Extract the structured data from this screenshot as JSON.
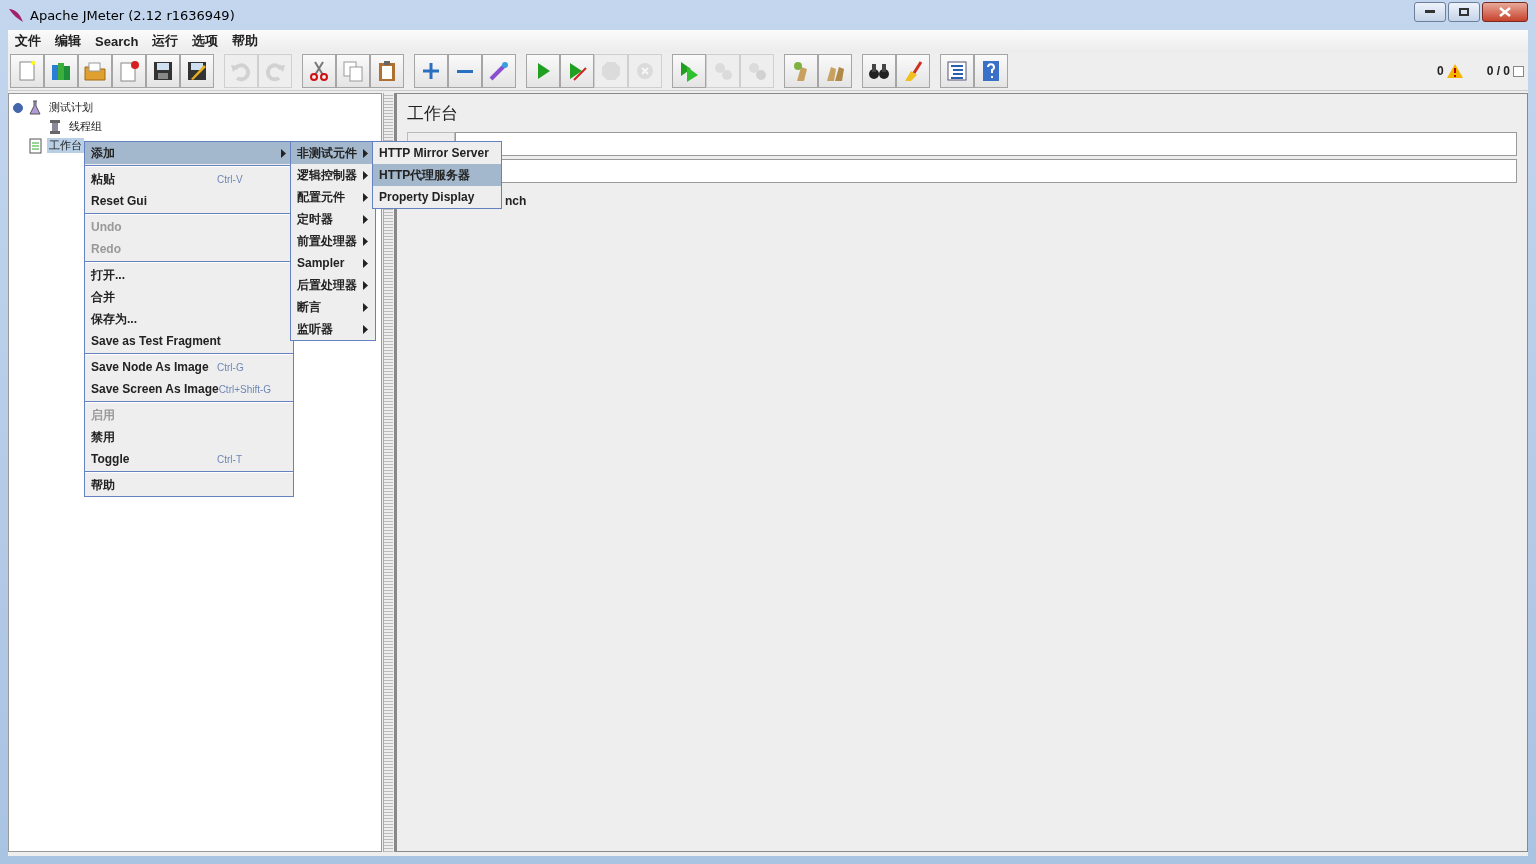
{
  "window": {
    "title": "Apache JMeter (2.12 r1636949)"
  },
  "menu_bar": [
    "文件",
    "编辑",
    "Search",
    "运行",
    "选项",
    "帮助"
  ],
  "toolbar": [
    [
      {
        "kind": "new",
        "disabled": false
      },
      {
        "kind": "templates",
        "disabled": false
      },
      {
        "kind": "open",
        "disabled": false
      },
      {
        "kind": "close",
        "disabled": false
      },
      {
        "kind": "save",
        "disabled": false
      },
      {
        "kind": "save-as",
        "disabled": false
      }
    ],
    [
      {
        "kind": "undo",
        "disabled": true
      },
      {
        "kind": "redo",
        "disabled": true
      }
    ],
    [
      {
        "kind": "cut",
        "disabled": false
      },
      {
        "kind": "copy",
        "disabled": false
      },
      {
        "kind": "paste",
        "disabled": false
      }
    ],
    [
      {
        "kind": "expand",
        "disabled": false
      },
      {
        "kind": "collapse",
        "disabled": false
      },
      {
        "kind": "toggle",
        "disabled": false
      }
    ],
    [
      {
        "kind": "start",
        "disabled": false
      },
      {
        "kind": "start-no-pause",
        "disabled": false
      },
      {
        "kind": "stop",
        "disabled": true
      },
      {
        "kind": "shutdown",
        "disabled": true
      }
    ],
    [
      {
        "kind": "remote-start",
        "disabled": false
      },
      {
        "kind": "remote-stop",
        "disabled": true
      },
      {
        "kind": "remote-shutdown",
        "disabled": true
      }
    ],
    [
      {
        "kind": "clear",
        "disabled": false
      },
      {
        "kind": "clear-all",
        "disabled": false
      }
    ],
    [
      {
        "kind": "search",
        "disabled": false
      },
      {
        "kind": "reset-search",
        "disabled": false
      }
    ],
    [
      {
        "kind": "function-helper",
        "disabled": false
      },
      {
        "kind": "help",
        "disabled": false
      }
    ]
  ],
  "status": {
    "warnings": "0",
    "threads": "0 / 0"
  },
  "tree": [
    {
      "label": "测试计划",
      "kind": "plan",
      "selected": false,
      "expanded": true,
      "children": [
        {
          "label": "线程组",
          "kind": "thread-group",
          "selected": false
        }
      ]
    },
    {
      "label": "工作台",
      "kind": "workbench",
      "selected": true
    }
  ],
  "panel": {
    "title": "工作台",
    "partial_text": "nch"
  },
  "context_menus": [
    {
      "items": [
        {
          "kind": "item",
          "label": "添加",
          "selected": true,
          "disabled": false,
          "submenu": true
        },
        {
          "kind": "separator"
        },
        {
          "kind": "item",
          "label": "粘贴",
          "shortcut": "Ctrl-V",
          "selected": false,
          "disabled": false,
          "submenu": false
        },
        {
          "kind": "item",
          "label": "Reset Gui",
          "selected": false,
          "disabled": false,
          "submenu": false
        },
        {
          "kind": "separator"
        },
        {
          "kind": "item",
          "label": "Undo",
          "selected": false,
          "disabled": true,
          "submenu": false
        },
        {
          "kind": "item",
          "label": "Redo",
          "selected": false,
          "disabled": true,
          "submenu": false
        },
        {
          "kind": "separator"
        },
        {
          "kind": "item",
          "label": "打开...",
          "selected": false,
          "disabled": false,
          "submenu": false
        },
        {
          "kind": "item",
          "label": "合并",
          "selected": false,
          "disabled": false,
          "submenu": false
        },
        {
          "kind": "item",
          "label": "保存为...",
          "selected": false,
          "disabled": false,
          "submenu": false
        },
        {
          "kind": "item",
          "label": "Save as Test Fragment",
          "selected": false,
          "disabled": false,
          "submenu": false
        },
        {
          "kind": "separator"
        },
        {
          "kind": "item",
          "label": "Save Node As Image",
          "shortcut": "Ctrl-G",
          "selected": false,
          "disabled": false,
          "submenu": false
        },
        {
          "kind": "item",
          "label": "Save Screen As Image",
          "shortcut": "Ctrl+Shift-G",
          "selected": false,
          "disabled": false,
          "submenu": false
        },
        {
          "kind": "separator"
        },
        {
          "kind": "item",
          "label": "启用",
          "selected": false,
          "disabled": true,
          "submenu": false
        },
        {
          "kind": "item",
          "label": "禁用",
          "selected": false,
          "disabled": false,
          "submenu": false
        },
        {
          "kind": "item",
          "label": "Toggle",
          "shortcut": "Ctrl-T",
          "selected": false,
          "disabled": false,
          "submenu": false
        },
        {
          "kind": "separator"
        },
        {
          "kind": "item",
          "label": "帮助",
          "selected": false,
          "disabled": false,
          "submenu": false
        }
      ]
    },
    {
      "items": [
        {
          "kind": "item",
          "label": "非测试元件",
          "selected": true,
          "disabled": false,
          "submenu": true
        },
        {
          "kind": "item",
          "label": "逻辑控制器",
          "selected": false,
          "disabled": false,
          "submenu": true
        },
        {
          "kind": "item",
          "label": "配置元件",
          "selected": false,
          "disabled": false,
          "submenu": true
        },
        {
          "kind": "item",
          "label": "定时器",
          "selected": false,
          "disabled": false,
          "submenu": true
        },
        {
          "kind": "item",
          "label": "前置处理器",
          "selected": false,
          "disabled": false,
          "submenu": true
        },
        {
          "kind": "item",
          "label": "Sampler",
          "selected": false,
          "disabled": false,
          "submenu": true
        },
        {
          "kind": "item",
          "label": "后置处理器",
          "selected": false,
          "disabled": false,
          "submenu": true
        },
        {
          "kind": "item",
          "label": "断言",
          "selected": false,
          "disabled": false,
          "submenu": true
        },
        {
          "kind": "item",
          "label": "监听器",
          "selected": false,
          "disabled": false,
          "submenu": true
        }
      ]
    },
    {
      "items": [
        {
          "kind": "item",
          "label": "HTTP Mirror Server",
          "selected": false,
          "disabled": false,
          "submenu": false
        },
        {
          "kind": "item",
          "label": "HTTP代理服务器",
          "selected": true,
          "disabled": false,
          "submenu": false
        },
        {
          "kind": "item",
          "label": "Property Display",
          "selected": false,
          "disabled": false,
          "submenu": false
        }
      ]
    }
  ]
}
